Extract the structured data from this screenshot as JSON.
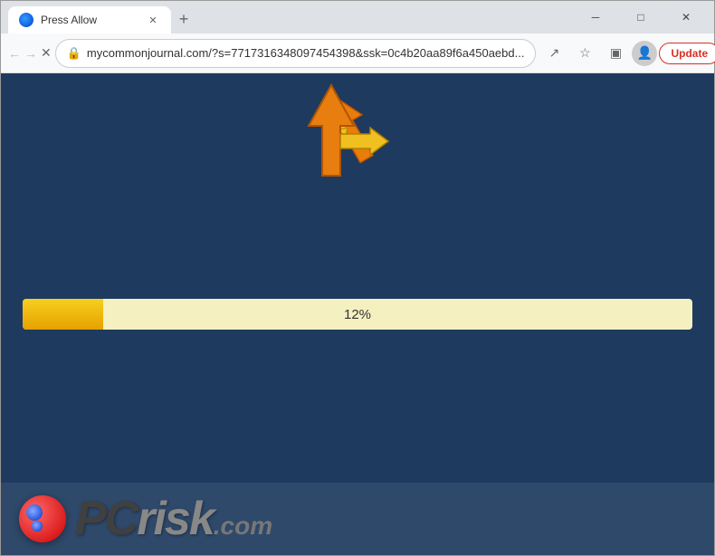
{
  "window": {
    "title": "Press Allow",
    "tab": {
      "title": "Press Allow",
      "favicon_alt": "browser tab favicon"
    },
    "new_tab_label": "+",
    "controls": {
      "minimize": "─",
      "maximize": "□",
      "close": "✕"
    }
  },
  "toolbar": {
    "back_label": "←",
    "forward_label": "→",
    "reload_label": "✕",
    "url": "mycommonjournal.com/?s=7717316348097454398&ssk=0c4b20aa89f6a450aebd...",
    "update_button_label": "Update",
    "share_icon": "↗",
    "star_icon": "☆",
    "sidebar_icon": "▣",
    "menu_icon": "⋮"
  },
  "webpage": {
    "background_color": "#1e3a5f",
    "progress_percent": 12,
    "progress_label": "12%",
    "progress_bar_color": "#e8a000",
    "progress_bg_color": "#f5f0c0"
  },
  "pcrisk": {
    "logo_text": "PC",
    "risk_text": "risk",
    "dot_com": ".com"
  }
}
